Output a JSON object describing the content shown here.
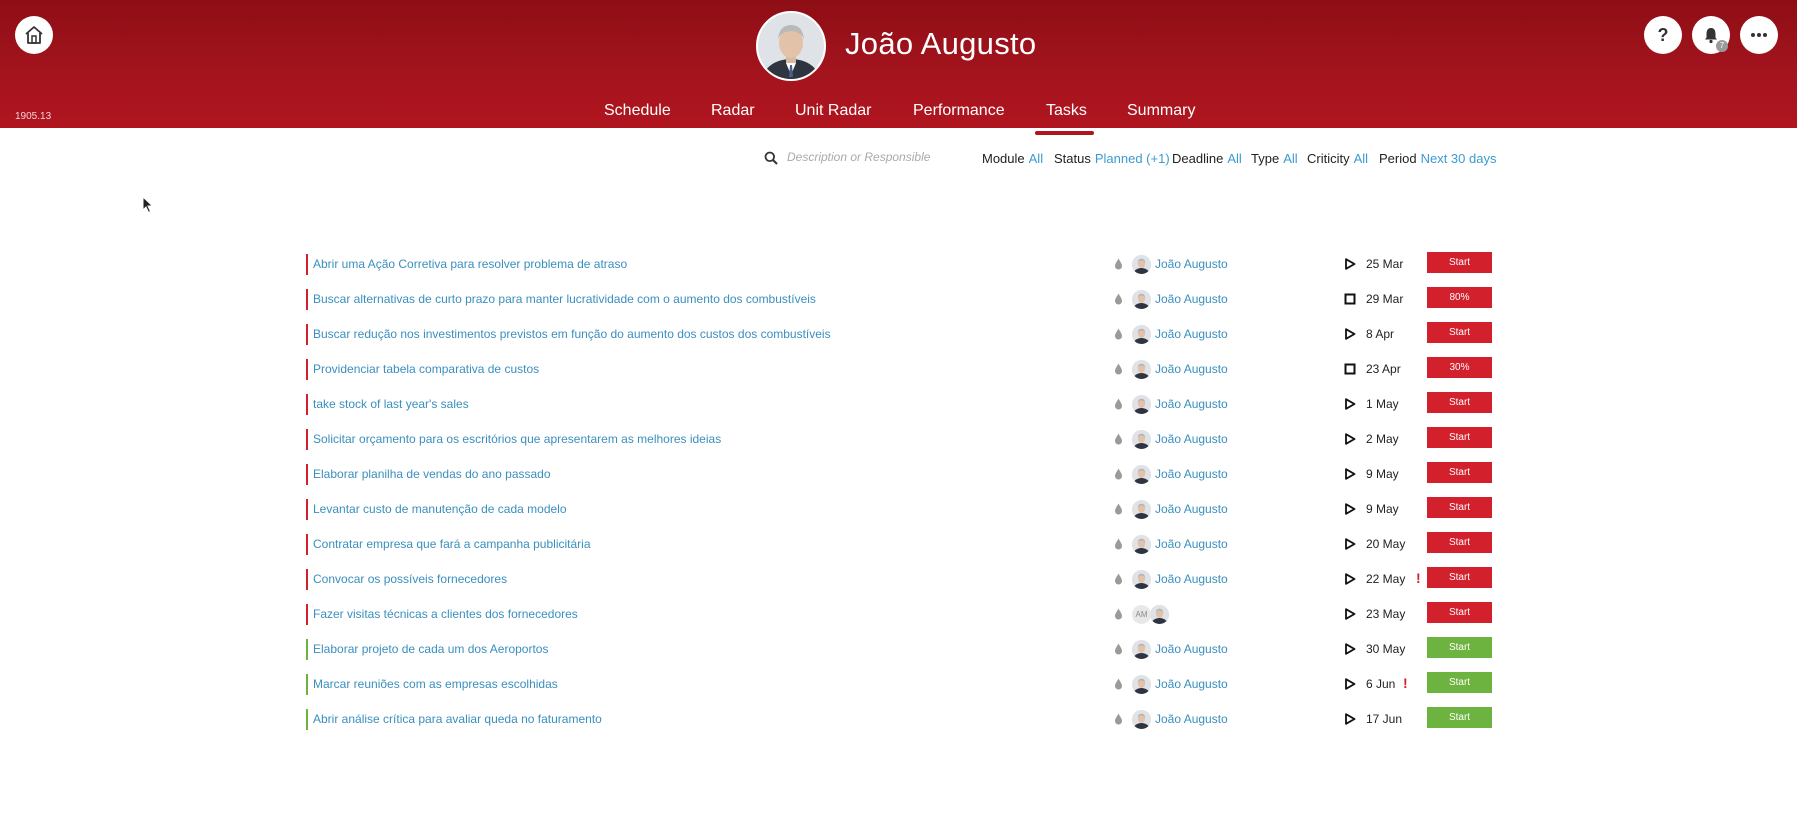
{
  "app": {
    "version": "1905.13"
  },
  "user": {
    "name": "João Augusto"
  },
  "notifications": {
    "count": "7"
  },
  "nav": {
    "tabs": [
      {
        "label": "Schedule"
      },
      {
        "label": "Radar"
      },
      {
        "label": "Unit Radar"
      },
      {
        "label": "Performance"
      },
      {
        "label": "Tasks",
        "active": true
      },
      {
        "label": "Summary"
      }
    ]
  },
  "search": {
    "placeholder": "Description or Responsible"
  },
  "filters": [
    {
      "label": "Module",
      "value": "All"
    },
    {
      "label": "Status",
      "value": "Planned (+1)"
    },
    {
      "label": "Deadline",
      "value": "All"
    },
    {
      "label": "Type",
      "value": "All"
    },
    {
      "label": "Criticity",
      "value": "All"
    },
    {
      "label": "Period",
      "value": "Next 30 days"
    }
  ],
  "colors": {
    "header": "#a3141d",
    "late": "#d2202c",
    "ontime": "#6db33f",
    "link": "#3a8fbe"
  },
  "tasks": [
    {
      "description": "Abrir uma Ação Corretiva para resolver problema de atraso",
      "responsible": "João Augusto",
      "status_icon": "play-icon",
      "deadline": "25 Mar",
      "action": "Start",
      "state": "late",
      "alert": ""
    },
    {
      "description": "Buscar alternativas de curto prazo para manter lucratividade com o aumento dos combustíveis",
      "responsible": "João Augusto",
      "status_icon": "stop-icon",
      "deadline": "29 Mar",
      "action": "80%",
      "state": "late",
      "alert": ""
    },
    {
      "description": "Buscar redução nos investimentos previstos em função do aumento dos custos dos combustíveis",
      "responsible": "João Augusto",
      "status_icon": "play-icon",
      "deadline": "8 Apr",
      "action": "Start",
      "state": "late",
      "alert": ""
    },
    {
      "description": "Providenciar tabela comparativa de custos",
      "responsible": "João Augusto",
      "status_icon": "stop-icon",
      "deadline": "23 Apr",
      "action": "30%",
      "state": "late",
      "alert": ""
    },
    {
      "description": "take stock of last year's sales",
      "responsible": "João Augusto",
      "status_icon": "play-icon",
      "deadline": "1 May",
      "action": "Start",
      "state": "late",
      "alert": ""
    },
    {
      "description": "Solicitar orçamento para os escritórios que apresentarem as melhores ideias",
      "responsible": "João Augusto",
      "status_icon": "play-icon",
      "deadline": "2 May",
      "action": "Start",
      "state": "late",
      "alert": ""
    },
    {
      "description": "Elaborar planilha de vendas do ano passado",
      "responsible": "João Augusto",
      "status_icon": "play-icon",
      "deadline": "9 May",
      "action": "Start",
      "state": "late",
      "alert": ""
    },
    {
      "description": "Levantar custo de manutenção de cada modelo",
      "responsible": "João Augusto",
      "status_icon": "play-icon",
      "deadline": "9 May",
      "action": "Start",
      "state": "late",
      "alert": ""
    },
    {
      "description": "Contratar empresa que fará a campanha publicitária",
      "responsible": "João Augusto",
      "status_icon": "play-icon",
      "deadline": "20 May",
      "action": "Start",
      "state": "late",
      "alert": ""
    },
    {
      "description": "Convocar os possíveis fornecedores",
      "responsible": "João Augusto",
      "status_icon": "play-icon",
      "deadline": "22 May",
      "action": "Start",
      "state": "late",
      "alert": "!"
    },
    {
      "description": "Fazer visitas técnicas a clientes dos fornecedores",
      "responsible": "",
      "initials": "AM",
      "status_icon": "play-icon",
      "deadline": "23 May",
      "action": "Start",
      "state": "late",
      "alert": ""
    },
    {
      "description": "Elaborar projeto de cada um dos Aeroportos",
      "responsible": "João Augusto",
      "status_icon": "play-icon",
      "deadline": "30 May",
      "action": "Start",
      "state": "ontime",
      "alert": ""
    },
    {
      "description": "Marcar reuniões com as empresas escolhidas",
      "responsible": "João Augusto",
      "status_icon": "play-icon",
      "deadline": "6 Jun",
      "action": "Start",
      "state": "ontime",
      "alert": "!"
    },
    {
      "description": "Abrir análise crítica para avaliar queda no faturamento",
      "responsible": "João Augusto",
      "status_icon": "play-icon",
      "deadline": "17 Jun",
      "action": "Start",
      "state": "ontime",
      "alert": ""
    }
  ]
}
